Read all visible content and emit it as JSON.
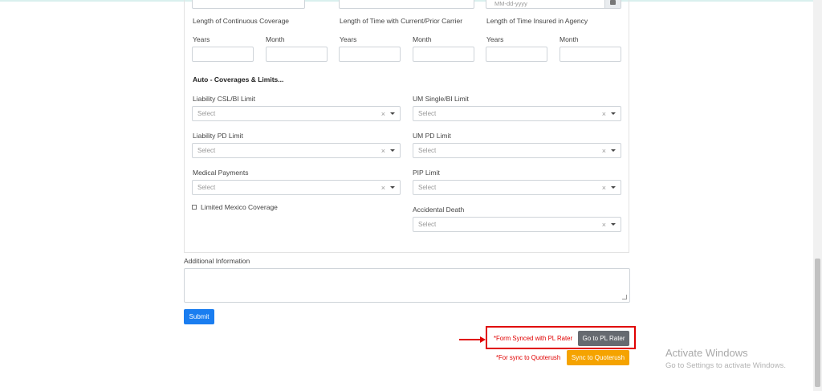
{
  "coverage": {
    "continuous_label": "Length of Continuous Coverage",
    "carrier_label": "Length of Time with Current/Prior Carrier",
    "agency_label": "Length of Time Insured in Agency",
    "years_label": "Years",
    "month_label": "Month",
    "date_placeholder": "MM-dd-yyyy"
  },
  "auto_section": {
    "title": "Auto - Coverages & Limits...",
    "select_placeholder": "Select",
    "clear_glyph": "×",
    "fields": {
      "liability_csl": "Liability CSL/BI Limit",
      "um_single": "UM Single/BI Limit",
      "liability_pd": "Liability PD Limit",
      "um_pd": "UM PD Limit",
      "medical_payments": "Medical Payments",
      "pip_limit": "PIP Limit",
      "accidental_death": "Accidental Death"
    },
    "limited_mexico": "Limited Mexico Coverage"
  },
  "additional_info": {
    "label": "Additional Information"
  },
  "actions": {
    "submit": "Submit",
    "synced_msg": "*Form Synced with PL Rater",
    "go_to_pl_rater": "Go to PL Rater",
    "sync_msg": "*For sync to Quoterush",
    "sync_quoterush": "Sync to Quoterush"
  },
  "watermark": {
    "title": "Activate Windows",
    "subtitle": "Go to Settings to activate Windows."
  },
  "colors": {
    "primary": "#1a7df0",
    "highlight": "#e00000",
    "gray_button": "#666a70",
    "orange_button": "#f5a300"
  }
}
